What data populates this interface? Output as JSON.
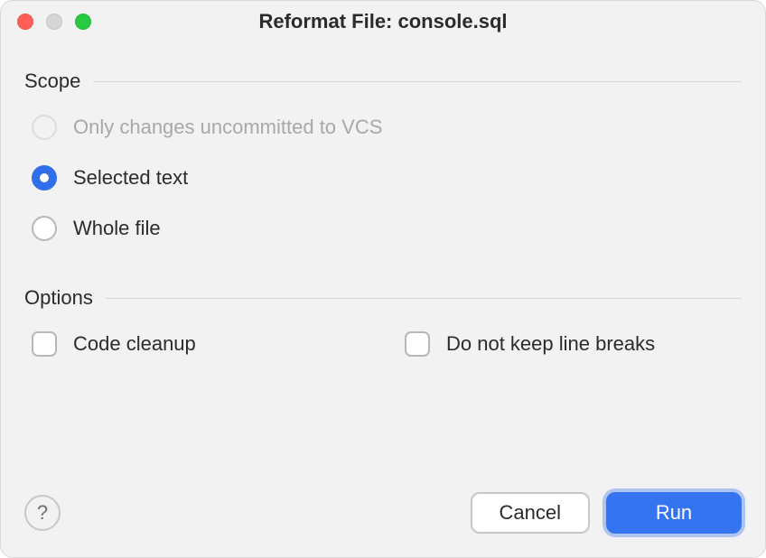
{
  "title": "Reformat File: console.sql",
  "sections": {
    "scope": {
      "label": "Scope",
      "options": {
        "vcs": "Only changes uncommitted to VCS",
        "selected": "Selected text",
        "whole": "Whole file"
      }
    },
    "options": {
      "label": "Options",
      "items": {
        "cleanup": "Code cleanup",
        "noLineBreaks": "Do not keep line breaks"
      }
    }
  },
  "buttons": {
    "help": "?",
    "cancel": "Cancel",
    "run": "Run"
  }
}
